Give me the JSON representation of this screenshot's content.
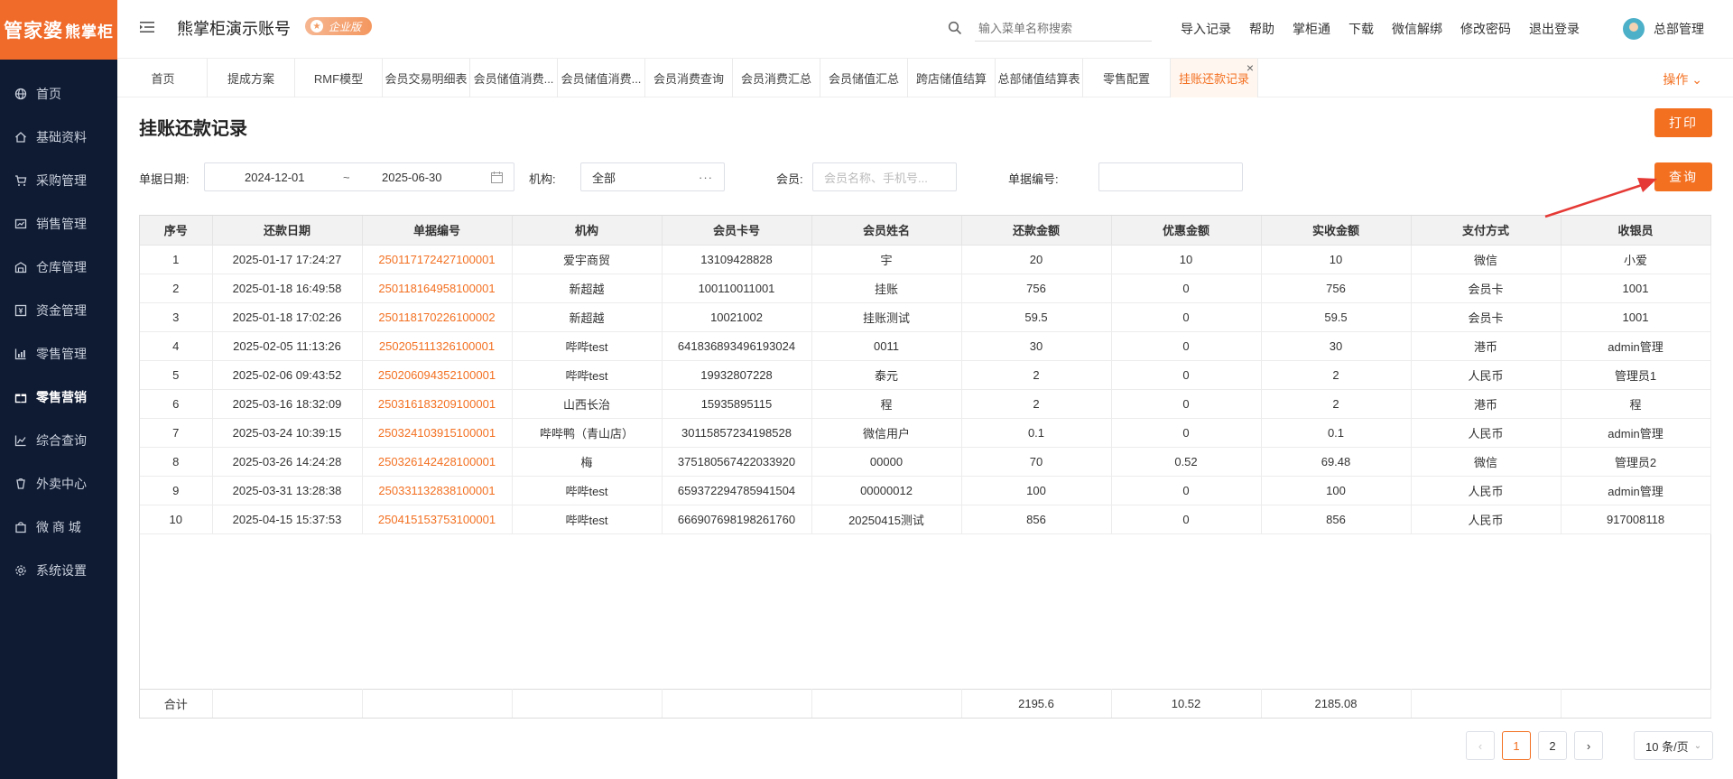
{
  "logo": {
    "text": "管家婆",
    "sub": "熊掌柜"
  },
  "sidebar": {
    "items": [
      {
        "label": "首页",
        "icon": "globe-icon"
      },
      {
        "label": "基础资料",
        "icon": "home-icon"
      },
      {
        "label": "采购管理",
        "icon": "cart-icon"
      },
      {
        "label": "销售管理",
        "icon": "sales-icon"
      },
      {
        "label": "仓库管理",
        "icon": "warehouse-icon"
      },
      {
        "label": "资金管理",
        "icon": "money-icon"
      },
      {
        "label": "零售管理",
        "icon": "chart-icon"
      },
      {
        "label": "零售营销",
        "icon": "gift-icon"
      },
      {
        "label": "综合查询",
        "icon": "bar-chart-icon"
      },
      {
        "label": "外卖中心",
        "icon": "delivery-icon"
      },
      {
        "label": "微 商 城",
        "icon": "bag-icon"
      },
      {
        "label": "系统设置",
        "icon": "gear-icon"
      }
    ],
    "active_index": 7
  },
  "header": {
    "account_title": "熊掌柜演示账号",
    "badge": "企业版",
    "search_placeholder": "输入菜单名称搜索",
    "links": [
      "导入记录",
      "帮助",
      "掌柜通",
      "下载",
      "微信解绑",
      "修改密码",
      "退出登录"
    ],
    "user_name": "总部管理"
  },
  "tabs": {
    "items": [
      "首页",
      "提成方案",
      "RMF模型",
      "会员交易明细表",
      "会员储值消费...",
      "会员储值消费...",
      "会员消费查询",
      "会员消费汇总",
      "会员储值汇总",
      "跨店储值结算",
      "总部储值结算表",
      "零售配置",
      "挂账还款记录"
    ],
    "active_index": 12,
    "ops_label": "操作"
  },
  "page": {
    "title": "挂账还款记录",
    "print_label": "打印",
    "query_label": "查询"
  },
  "filters": {
    "date_label": "单据日期:",
    "date_start": "2024-12-01",
    "date_sep": "~",
    "date_end": "2025-06-30",
    "org_label": "机构:",
    "org_value": "全部",
    "member_label": "会员:",
    "member_placeholder": "会员名称、手机号...",
    "docno_label": "单据编号:",
    "docno_value": ""
  },
  "table": {
    "columns": [
      "序号",
      "还款日期",
      "单据编号",
      "机构",
      "会员卡号",
      "会员姓名",
      "还款金额",
      "优惠金额",
      "实收金额",
      "支付方式",
      "收银员"
    ],
    "rows": [
      [
        "1",
        "2025-01-17 17:24:27",
        "250117172427100001",
        "爱宇商贸",
        "13109428828",
        "宇",
        "20",
        "10",
        "10",
        "微信",
        "小爱"
      ],
      [
        "2",
        "2025-01-18 16:49:58",
        "250118164958100001",
        "新超越",
        "100110011001",
        "挂账",
        "756",
        "0",
        "756",
        "会员卡",
        "1001"
      ],
      [
        "3",
        "2025-01-18 17:02:26",
        "250118170226100002",
        "新超越",
        "10021002",
        "挂账测试",
        "59.5",
        "0",
        "59.5",
        "会员卡",
        "1001"
      ],
      [
        "4",
        "2025-02-05 11:13:26",
        "250205111326100001",
        "哔哔test",
        "641836893496193024",
        "0011",
        "30",
        "0",
        "30",
        "港币",
        "admin管理"
      ],
      [
        "5",
        "2025-02-06 09:43:52",
        "250206094352100001",
        "哔哔test",
        "19932807228",
        "泰元",
        "2",
        "0",
        "2",
        "人民币",
        "管理员1"
      ],
      [
        "6",
        "2025-03-16 18:32:09",
        "250316183209100001",
        "山西长治",
        "15935895115",
        "程",
        "2",
        "0",
        "2",
        "港币",
        "程"
      ],
      [
        "7",
        "2025-03-24 10:39:15",
        "250324103915100001",
        "哔哔鸭（青山店）",
        "30115857234198528",
        "微信用户",
        "0.1",
        "0",
        "0.1",
        "人民币",
        "admin管理"
      ],
      [
        "8",
        "2025-03-26 14:24:28",
        "250326142428100001",
        "梅",
        "375180567422033920",
        "00000",
        "70",
        "0.52",
        "69.48",
        "微信",
        "管理员2"
      ],
      [
        "9",
        "2025-03-31 13:28:38",
        "250331132838100001",
        "哔哔test",
        "659372294785941504",
        "00000012",
        "100",
        "0",
        "100",
        "人民币",
        "admin管理"
      ],
      [
        "10",
        "2025-04-15 15:37:53",
        "250415153753100001",
        "哔哔test",
        "666907698198261760",
        "20250415测试",
        "856",
        "0",
        "856",
        "人民币",
        "917008118"
      ]
    ],
    "totals": {
      "label": "合计",
      "repay": "2195.6",
      "discount": "10.52",
      "received": "2185.08"
    }
  },
  "pagination": {
    "prev": "‹",
    "pages": [
      "1",
      "2"
    ],
    "current": "1",
    "next": "›",
    "page_size": "10 条/页"
  },
  "colors": {
    "accent": "#f37021",
    "sidebar_bg": "#0f1b33"
  }
}
